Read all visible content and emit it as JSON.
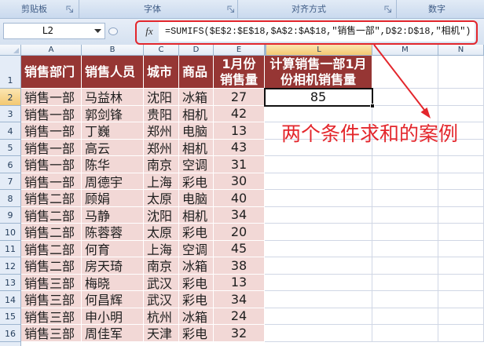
{
  "ribbon": {
    "groups": [
      {
        "label": "剪贴板",
        "launcher_icon": "dialog-launcher-icon"
      },
      {
        "label": "字体",
        "launcher_icon": "dialog-launcher-icon"
      },
      {
        "label": "对齐方式",
        "launcher_icon": "dialog-launcher-icon"
      },
      {
        "label": "数字"
      }
    ]
  },
  "formula_bar": {
    "name_box": "L2",
    "name_box_icon": "chevron-down-icon",
    "fx_label": "fx",
    "formula": "=SUMIFS($E$2:$E$18,$A$2:$A$18,\"销售一部\",D$2:D$18,\"相机\")"
  },
  "sheet": {
    "column_headers": [
      "A",
      "B",
      "C",
      "D",
      "E",
      "L",
      "M",
      "N"
    ],
    "row_headers": [
      "1",
      "2",
      "3",
      "4",
      "5",
      "6",
      "7",
      "8",
      "9",
      "10",
      "11",
      "12",
      "13",
      "14",
      "15",
      "16"
    ],
    "header_row": [
      [
        "销售部门"
      ],
      [
        "销售人员"
      ],
      [
        "城市"
      ],
      [
        "商品"
      ],
      [
        "1月份",
        "销售量"
      ],
      [
        "计算销售一部1月",
        "份相机销售量"
      ],
      [],
      []
    ],
    "data_rows": [
      [
        "销售一部",
        "马益林",
        "沈阳",
        "冰箱",
        "27",
        "85",
        "",
        ""
      ],
      [
        "销售一部",
        "郭剑锋",
        "贵阳",
        "相机",
        "42",
        "",
        "",
        ""
      ],
      [
        "销售一部",
        "丁巍",
        "郑州",
        "电脑",
        "13",
        "",
        "",
        ""
      ],
      [
        "销售一部",
        "高云",
        "郑州",
        "相机",
        "43",
        "",
        "",
        ""
      ],
      [
        "销售一部",
        "陈华",
        "南京",
        "空调",
        "31",
        "",
        "",
        ""
      ],
      [
        "销售一部",
        "周德宇",
        "上海",
        "彩电",
        "30",
        "",
        "",
        ""
      ],
      [
        "销售二部",
        "顾娟",
        "太原",
        "电脑",
        "40",
        "",
        "",
        ""
      ],
      [
        "销售二部",
        "马静",
        "沈阳",
        "相机",
        "34",
        "",
        "",
        ""
      ],
      [
        "销售二部",
        "陈蓉蓉",
        "太原",
        "彩电",
        "20",
        "",
        "",
        ""
      ],
      [
        "销售二部",
        "何育",
        "上海",
        "空调",
        "45",
        "",
        "",
        ""
      ],
      [
        "销售二部",
        "房天琦",
        "南京",
        "冰箱",
        "38",
        "",
        "",
        ""
      ],
      [
        "销售三部",
        "梅晓",
        "武汉",
        "彩电",
        "13",
        "",
        "",
        ""
      ],
      [
        "销售三部",
        "何昌辉",
        "武汉",
        "彩电",
        "34",
        "",
        "",
        ""
      ],
      [
        "销售三部",
        "申小明",
        "杭州",
        "冰箱",
        "24",
        "",
        "",
        ""
      ],
      [
        "销售三部",
        "周佳军",
        "天津",
        "彩电",
        "32",
        "",
        "",
        ""
      ]
    ]
  },
  "annotation": {
    "text": "两个条件求和的案例"
  },
  "colors": {
    "header_fill": "#963634",
    "data_fill": "#F2D8D6",
    "annotation_red": "#E3262C",
    "active_header_highlight": "#F3C871",
    "gridline": "#D0D7E5"
  }
}
